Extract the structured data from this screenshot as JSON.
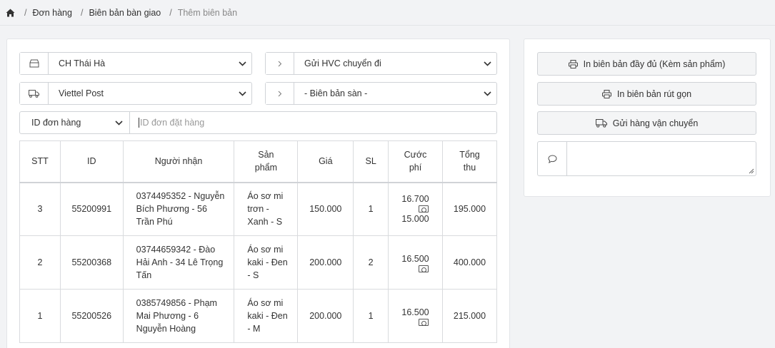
{
  "breadcrumb": {
    "items": [
      "Đơn hàng",
      "Biên bản bàn giao"
    ],
    "current": "Thêm biên bản"
  },
  "filters": {
    "store": "CH Thái Hà",
    "action": "Gửi HVC chuyển đi",
    "carrier": "Viettel Post",
    "record": "- Biên bản sàn -",
    "id_type": "ID đơn hàng",
    "order_id_placeholder": "ID đơn đặt hàng"
  },
  "table": {
    "headers": [
      "STT",
      "ID",
      "Người nhận",
      "Sản phẩm",
      "Giá",
      "SL",
      "Cước phí",
      "Tổng thu"
    ],
    "rows": [
      {
        "stt": "3",
        "id": "55200991",
        "receiver": "0374495352 - Nguyễn Bích Phương - 56 Trần Phú",
        "product": "Áo sơ mi trơn - Xanh - S",
        "price": "150.000",
        "qty": "1",
        "fee": "16.700",
        "fee_extra": "15.000",
        "total": "195.000"
      },
      {
        "stt": "2",
        "id": "55200368",
        "receiver": "03744659342 - Đào Hải Anh - 34 Lê Trọng Tấn",
        "product": "Áo sơ mi kaki - Đen - S",
        "price": "200.000",
        "qty": "2",
        "fee": "16.500",
        "fee_extra": "",
        "total": "400.000"
      },
      {
        "stt": "1",
        "id": "55200526",
        "receiver": "0385749856 - Phạm Mai Phương - 6 Nguyễn Hoàng",
        "product": "Áo sơ mi kaki - Đen - M",
        "price": "200.000",
        "qty": "1",
        "fee": "16.500",
        "fee_extra": "",
        "total": "215.000"
      }
    ]
  },
  "actions": {
    "print_full": "In biên bản đầy đủ (Kèm sản phẩm)",
    "print_short": "In biên bản rút gọn",
    "send_shipping": "Gửi hàng vận chuyển",
    "note_value": ""
  }
}
